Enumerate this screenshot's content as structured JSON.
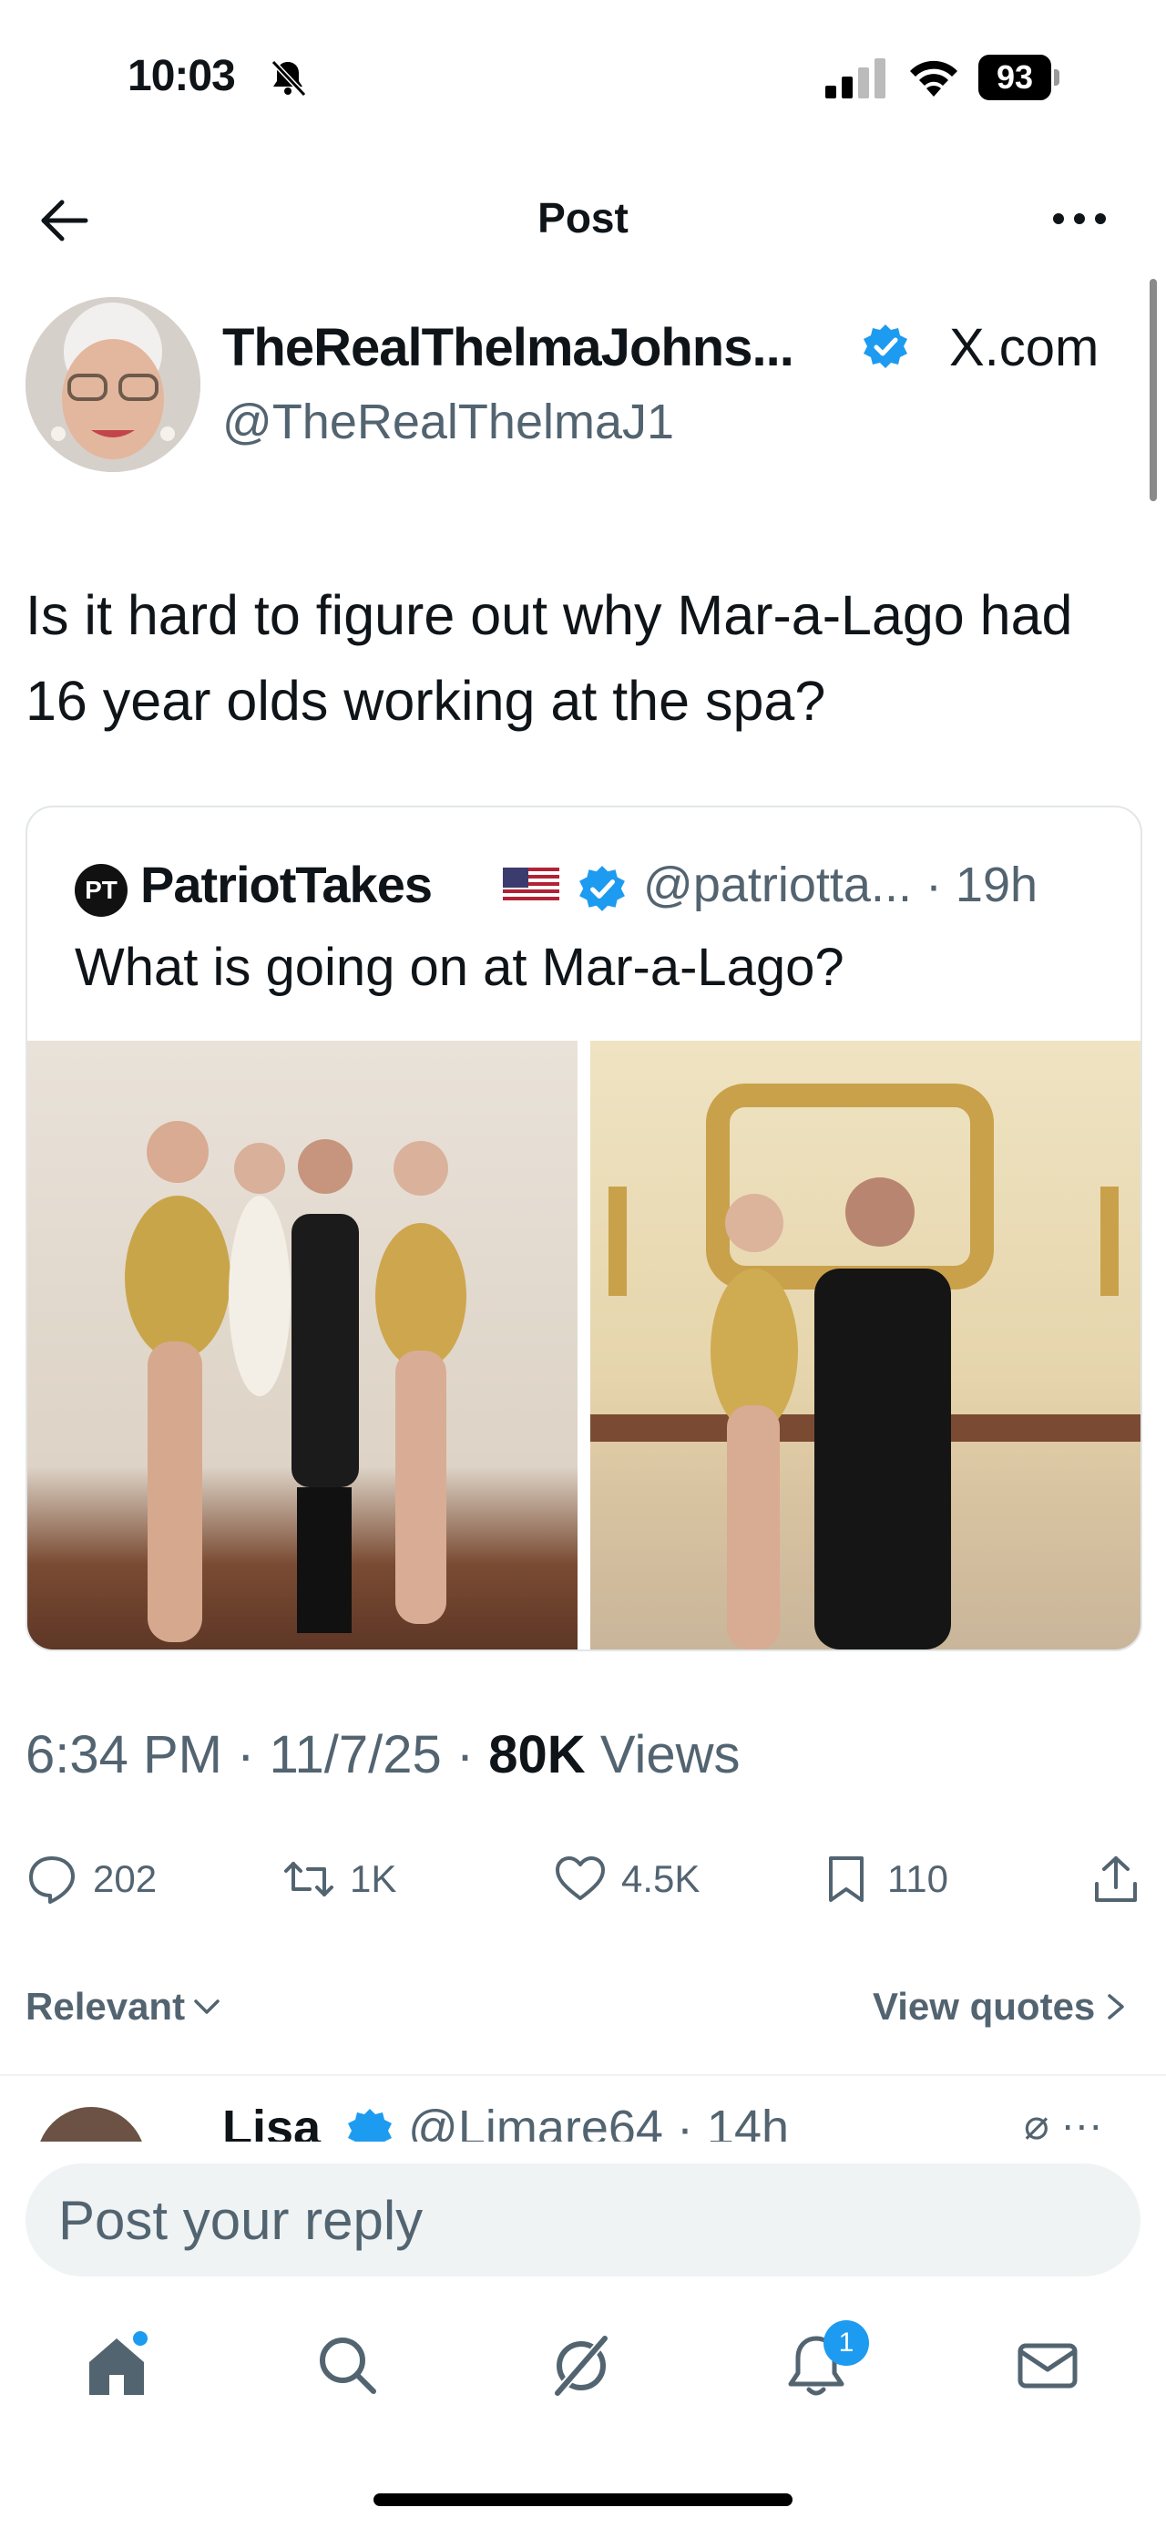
{
  "status_bar": {
    "time": "10:03",
    "battery": "93"
  },
  "header": {
    "title": "Post"
  },
  "author": {
    "display_name": "TheRealThelmaJohns...",
    "handle": "@TheRealThelmaJ1",
    "source": "X.com"
  },
  "tweet": {
    "text": "Is it hard to figure out why Mar-a-Lago had 16 year olds working at the spa?"
  },
  "quote": {
    "badge": "PT",
    "name": "PatriotTakes",
    "handle_time": "@patriotta... · 19h",
    "text": "What is going on at Mar-a-Lago?"
  },
  "meta": {
    "time_date": "6:34 PM · 11/7/25 · ",
    "views_count": "80K",
    "views_label": " Views"
  },
  "actions": {
    "replies": "202",
    "reposts": "1K",
    "likes": "4.5K",
    "bookmarks": "110"
  },
  "sort": {
    "label": "Relevant",
    "view_quotes": "View quotes"
  },
  "reply_peek": {
    "name": "Lisa",
    "handle_time": "@Limare64 · 14h"
  },
  "compose": {
    "placeholder": "Post your reply"
  },
  "notifications": {
    "badge": "1"
  }
}
